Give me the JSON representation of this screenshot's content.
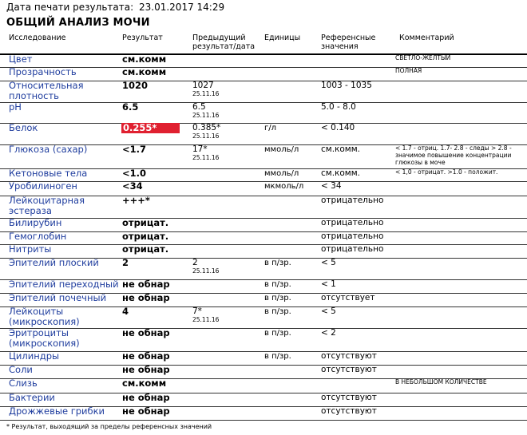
{
  "print_label": "Дата печати результата:",
  "print_date": "23.01.2017 14:29",
  "title": "ОБЩИЙ АНАЛИЗ МОЧИ",
  "headers": {
    "test": "Исследование",
    "result": "Результат",
    "previous": "Предыдущий результат/дата",
    "units": "Единицы",
    "reference": "Референсные значения",
    "comment": "Комментарий"
  },
  "rows": [
    {
      "name": "Цвет",
      "result": "см.комм",
      "prev": "",
      "prev_date": "",
      "unit": "",
      "ref": "",
      "comment": "СВЕТЛО-ЖЕЛТЫЙ",
      "flag": false
    },
    {
      "name": "Прозрачность",
      "result": "см.комм",
      "prev": "",
      "prev_date": "",
      "unit": "",
      "ref": "",
      "comment": "ПОЛНАЯ",
      "flag": false
    },
    {
      "name": "Относительная плотность",
      "result": "1020",
      "prev": "1027",
      "prev_date": "25.11.16",
      "unit": "",
      "ref": "1003 - 1035",
      "comment": "",
      "flag": false
    },
    {
      "name": "pH",
      "result": "6.5",
      "prev": "6.5",
      "prev_date": "25.11.16",
      "unit": "",
      "ref": "5.0 - 8.0",
      "comment": "",
      "flag": false
    },
    {
      "name": "Белок",
      "result": "0.255*",
      "prev": "0.385*",
      "prev_date": "25.11.16",
      "unit": "г/л",
      "ref": "< 0.140",
      "comment": "",
      "flag": true
    },
    {
      "name": "Глюкоза (сахар)",
      "result": "<1.7",
      "prev": "17*",
      "prev_date": "25.11.16",
      "unit": "ммоль/л",
      "ref": "см.комм.",
      "comment": "< 1.7 - отриц. 1.7- 2.8 - следы > 2.8 - значимое повышение концентрации глюкозы в моче",
      "flag": false
    },
    {
      "name": "Кетоновые тела",
      "result": "<1.0",
      "prev": "",
      "prev_date": "",
      "unit": "ммоль/л",
      "ref": "см.комм.",
      "comment": "< 1,0 - отрицат. >1.0 - положит.",
      "flag": false
    },
    {
      "name": "Уробилиноген",
      "result": "<34",
      "prev": "",
      "prev_date": "",
      "unit": "мкмоль/л",
      "ref": "< 34",
      "comment": "",
      "flag": false
    },
    {
      "name": "Лейкоцитарная эстераза",
      "result": "+++*",
      "prev": "",
      "prev_date": "",
      "unit": "",
      "ref": "отрицательно",
      "comment": "",
      "flag": false
    },
    {
      "name": "Билирубин",
      "result": "отрицат.",
      "prev": "",
      "prev_date": "",
      "unit": "",
      "ref": "отрицательно",
      "comment": "",
      "flag": false
    },
    {
      "name": "Гемоглобин",
      "result": "отрицат.",
      "prev": "",
      "prev_date": "",
      "unit": "",
      "ref": "отрицательно",
      "comment": "",
      "flag": false
    },
    {
      "name": "Нитриты",
      "result": "отрицат.",
      "prev": "",
      "prev_date": "",
      "unit": "",
      "ref": "отрицательно",
      "comment": "",
      "flag": false
    },
    {
      "name": "Эпителий плоский",
      "result": "2",
      "prev": "2",
      "prev_date": "25.11.16",
      "unit": "в п/зр.",
      "ref": "< 5",
      "comment": "",
      "flag": false
    },
    {
      "name": "Эпителий переходный",
      "result": "не обнар",
      "prev": "",
      "prev_date": "",
      "unit": "в п/зр.",
      "ref": "< 1",
      "comment": "",
      "flag": false
    },
    {
      "name": "Эпителий почечный",
      "result": "не обнар",
      "prev": "",
      "prev_date": "",
      "unit": "в п/зр.",
      "ref": "отсутствует",
      "comment": "",
      "flag": false
    },
    {
      "name": "Лейкоциты (микроскопия)",
      "result": "4",
      "prev": "7*",
      "prev_date": "25.11.16",
      "unit": "в п/зр.",
      "ref": "< 5",
      "comment": "",
      "flag": false
    },
    {
      "name": "Эритроциты (микроскопия)",
      "result": "не обнар",
      "prev": "",
      "prev_date": "",
      "unit": "в п/зр.",
      "ref": "< 2",
      "comment": "",
      "flag": false
    },
    {
      "name": "Цилиндры",
      "result": "не обнар",
      "prev": "",
      "prev_date": "",
      "unit": "в п/зр.",
      "ref": "отсутствуют",
      "comment": "",
      "flag": false
    },
    {
      "name": "Соли",
      "result": "не обнар",
      "prev": "",
      "prev_date": "",
      "unit": "",
      "ref": "отсутствуют",
      "comment": "",
      "flag": false
    },
    {
      "name": "Слизь",
      "result": "см.комм",
      "prev": "",
      "prev_date": "",
      "unit": "",
      "ref": "",
      "comment": "В НЕБОЛЬШОМ КОЛИЧЕСТВЕ",
      "flag": false
    },
    {
      "name": "Бактерии",
      "result": "не обнар",
      "prev": "",
      "prev_date": "",
      "unit": "",
      "ref": "отсутствуют",
      "comment": "",
      "flag": false
    },
    {
      "name": "Дрожжевые грибки",
      "result": "не обнар",
      "prev": "",
      "prev_date": "",
      "unit": "",
      "ref": "отсутствуют",
      "comment": "",
      "flag": false
    }
  ],
  "footnote": "* Результат, выходящий за пределы референсных значений"
}
